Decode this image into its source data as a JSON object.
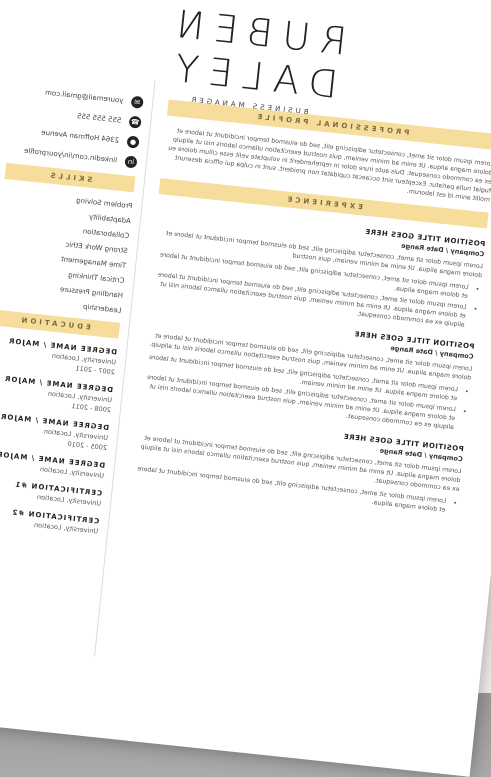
{
  "header": {
    "name": "RUBEN DALEY",
    "title": "BUSINESS MANAGER"
  },
  "contact": {
    "email": "youremail@gmail.com",
    "phone": "555 555 555",
    "address": "2364 Hoffman Avenue",
    "linkedin": "linkedin.com/in/yourprofile"
  },
  "sections": {
    "profile": "PROFESSIONAL PROFILE",
    "skills": "SKILLS",
    "experience": "EXPERIENCE",
    "education": "EDUCATION"
  },
  "profile_text": "Lorem ipsum dolor sit amet, consectetur adipiscing elit, sed do eiusmod tempor incididunt ut labore et dolore magna aliqua. Ut enim ad minim veniam, quis nostrud exercitation ullamco laboris nisi ut aliquip ex ea commodo consequat. Duis aute irure dolor in reprehenderit in voluptate velit esse cillum dolore eu fugiat nulla pariatur. Excepteur sint occaecat cupidatat non proident, sunt in culpa qui officia deserunt mollit anim id est laborum.",
  "skills": [
    "Problem Solving",
    "Adaptability",
    "Collaboration",
    "Strong Work Ethic",
    "Time Management",
    "Critical Thinking",
    "Handling Pressure",
    "Leadership"
  ],
  "education": [
    {
      "degree": "DEGREE NAME / MAJOR",
      "school": "University, Location",
      "years": "2007 - 2011"
    },
    {
      "degree": "DEGREE NAME / MAJOR",
      "school": "University, Location",
      "years": "2008 - 2011"
    },
    {
      "degree": "DEGREE NAME / MAJOR",
      "school": "University, Location",
      "years": "2005 - 2010"
    },
    {
      "degree": "DEGREE NAME / MAJOR",
      "school": "University, Location",
      "years": ""
    },
    {
      "degree": "CERTIFICATION #1",
      "school": "University, Location",
      "years": ""
    },
    {
      "degree": "CERTIFICATION #2",
      "school": "University, Location",
      "years": ""
    }
  ],
  "jobs": [
    {
      "title": "POSITION TITLE GOES HERE",
      "company": "Company / Date Range",
      "summary": "Lorem ipsum dolor sit amet, consectetur adipiscing elit, sed do eiusmod tempor incididunt ut labore et dolore magna aliqua. Ut enim ad minim veniam, quis nostrud",
      "bullets": [
        "Lorem ipsum dolor sit amet, consectetur adipiscing elit, sed do eiusmod tempor incididunt ut labore et dolore magna aliqua.",
        "Lorem ipsum dolor sit amet, consectetur adipiscing elit, sed do eiusmod tempor incididunt ut labore et dolore magna aliqua. Ut enim ad minim veniam, quis nostrud exercitation ullamco laboris nisi ut aliquip ex ea commodo consequat."
      ]
    },
    {
      "title": "POSITION TITLE GOES HERE",
      "company": "Company / Date Range",
      "summary": "Lorem ipsum dolor sit amet, consectetur adipiscing elit, sed do eiusmod tempor incididunt ut labore et dolore magna aliqua. Ut enim ad minim veniam, quis nostrud exercitation ullamco laboris nisi ut aliquip.",
      "bullets": [
        "Lorem ipsum dolor sit amet, consectetur adipiscing elit, sed do eiusmod tempor incididunt ut labore et dolore magna aliqua. Ut enim ad minim veniam.",
        "Lorem ipsum dolor sit amet, consectetur adipiscing elit, sed do eiusmod tempor incididunt ut labore et dolore magna aliqua. Ut enim ad minim veniam, quis nostrud exercitation ullamco laboris nisi ut aliquip ex ea commodo consequat."
      ]
    },
    {
      "title": "POSITION TITLE GOES HERE",
      "company": "Company / Date Range",
      "summary": "Lorem ipsum dolor sit amet, consectetur adipiscing elit, sed do eiusmod tempor incididunt ut labore et dolore magna aliqua. Ut enim ad minim veniam, quis nostrud exercitation ullamco laboris nisi ut aliquip ex ea commodo consequat.",
      "bullets": [
        "Lorem ipsum dolor sit amet, consectetur adipiscing elit, sed do eiusmod tempor incididunt ut labore et dolore magna aliqua."
      ]
    }
  ]
}
